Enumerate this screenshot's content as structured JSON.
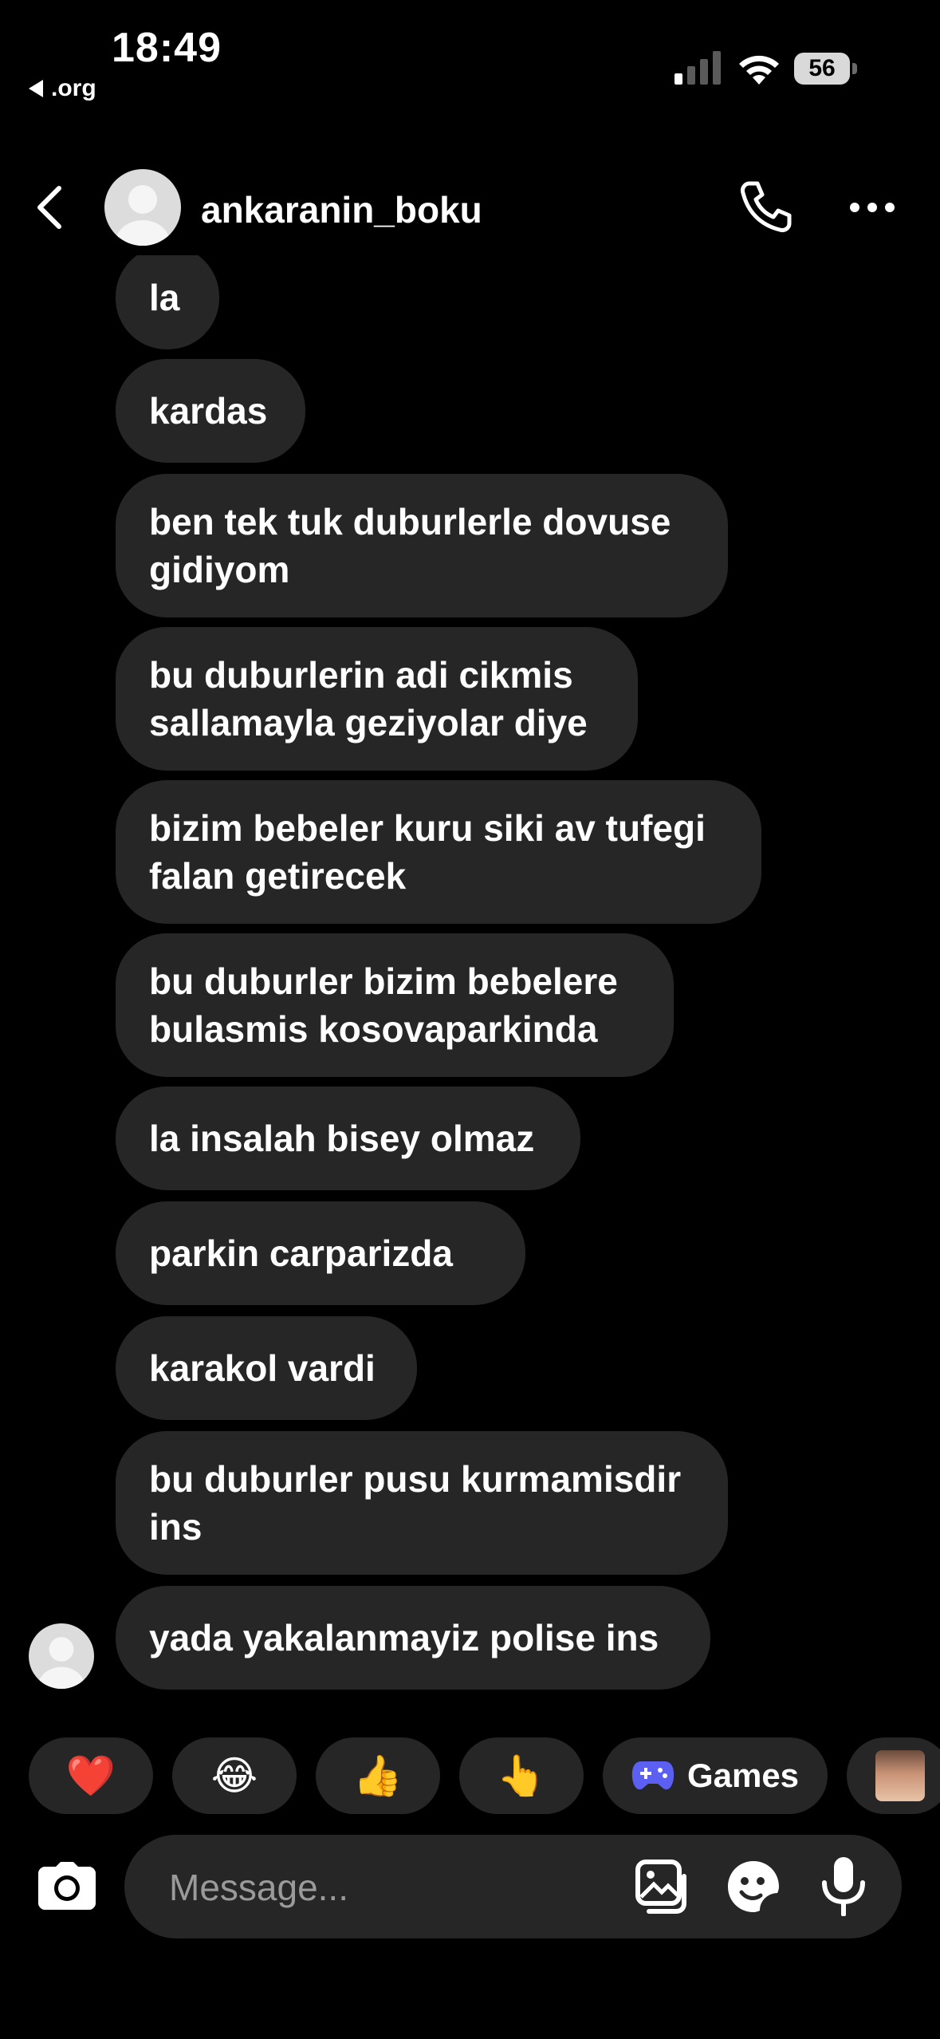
{
  "status_bar": {
    "time": "18:49",
    "back_app": ".org",
    "battery": "56"
  },
  "header": {
    "username": "ankaranin_boku"
  },
  "messages": [
    {
      "text": "la"
    },
    {
      "text": "kardas"
    },
    {
      "text": "ben tek tuk duburlerle dovuse\ngidiyom"
    },
    {
      "text": "bu duburlerin adi cikmis\nsallamayla geziyolar diye"
    },
    {
      "text": "bizim bebeler kuru siki av tufegi\nfalan getirecek"
    },
    {
      "text": "bu duburler bizim bebelere\nbulasmis kosovaparkinda"
    },
    {
      "text": "la insalah bisey olmaz"
    },
    {
      "text": "parkin carparizda"
    },
    {
      "text": "karakol vardi"
    },
    {
      "text": "bu duburler pusu kurmamisdir\nins"
    },
    {
      "text": "yada yakalanmayiz polise ins"
    }
  ],
  "reactions": [
    {
      "emoji": "❤️"
    },
    {
      "emoji": "😂"
    },
    {
      "emoji": "👍"
    },
    {
      "emoji": "👆"
    },
    {
      "label": "Games"
    }
  ],
  "composer": {
    "placeholder": "Message..."
  },
  "colors": {
    "background": "#000000",
    "bubble": "#262626",
    "games_icon": "#5b5ff2"
  }
}
